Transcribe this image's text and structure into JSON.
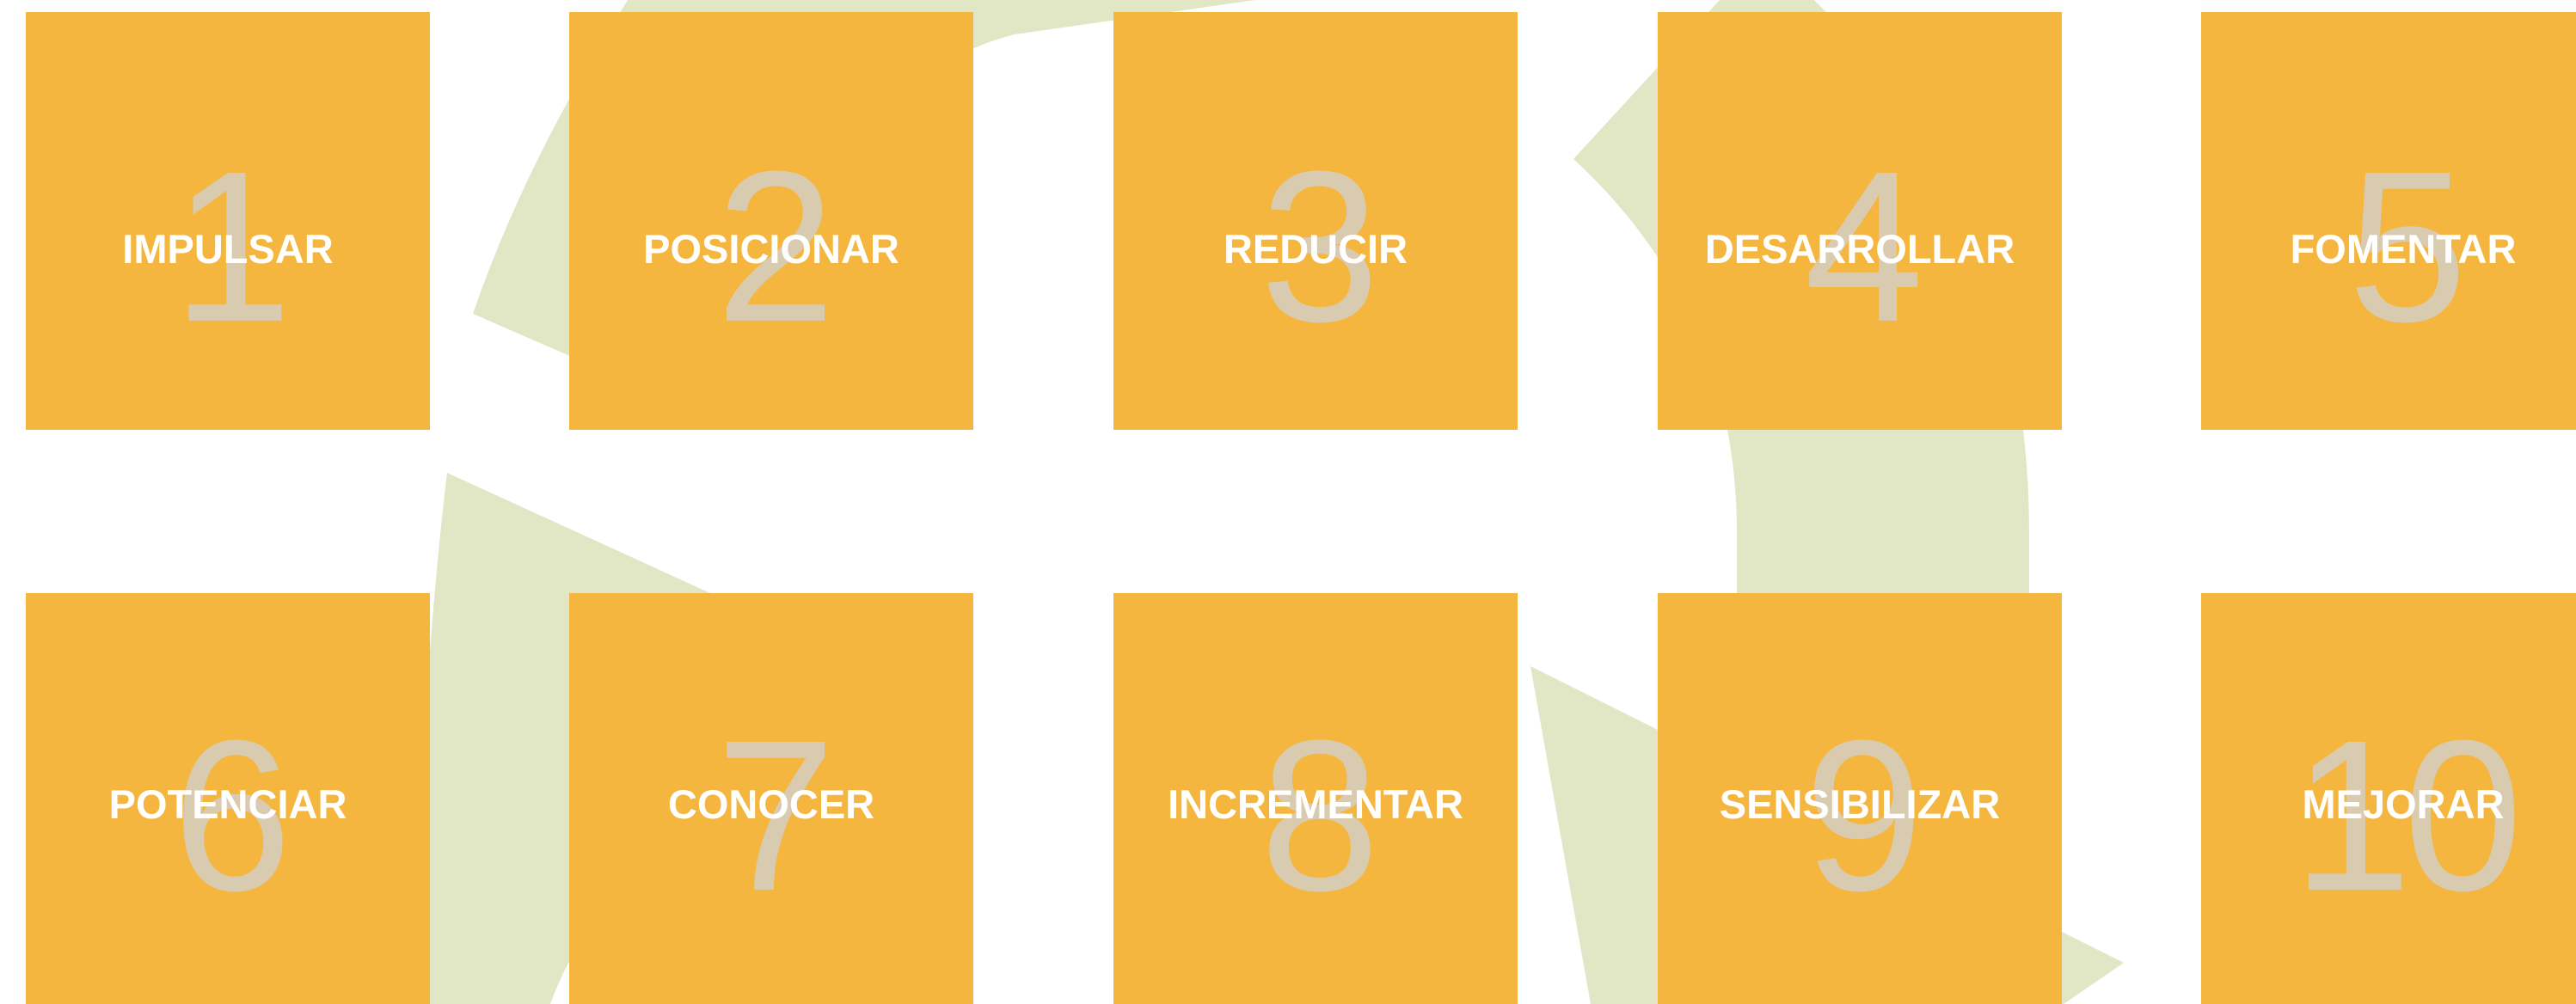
{
  "colors": {
    "tile": "#f4b63f",
    "number": "#d9cbb0",
    "label": "#ffffff",
    "background_art": "#e1e7c4"
  },
  "tiles": [
    {
      "number": "1",
      "label": "IMPULSAR"
    },
    {
      "number": "2",
      "label": "POSICIONAR"
    },
    {
      "number": "3",
      "label": "REDUCIR"
    },
    {
      "number": "4",
      "label": "DESARROLLAR"
    },
    {
      "number": "5",
      "label": "FOMENTAR"
    },
    {
      "number": "6",
      "label": "POTENCIAR"
    },
    {
      "number": "7",
      "label": "CONOCER"
    },
    {
      "number": "8",
      "label": "INCREMENTAR"
    },
    {
      "number": "9",
      "label": "SENSIBILIZAR"
    },
    {
      "number": "10",
      "label": "MEJORAR"
    }
  ]
}
